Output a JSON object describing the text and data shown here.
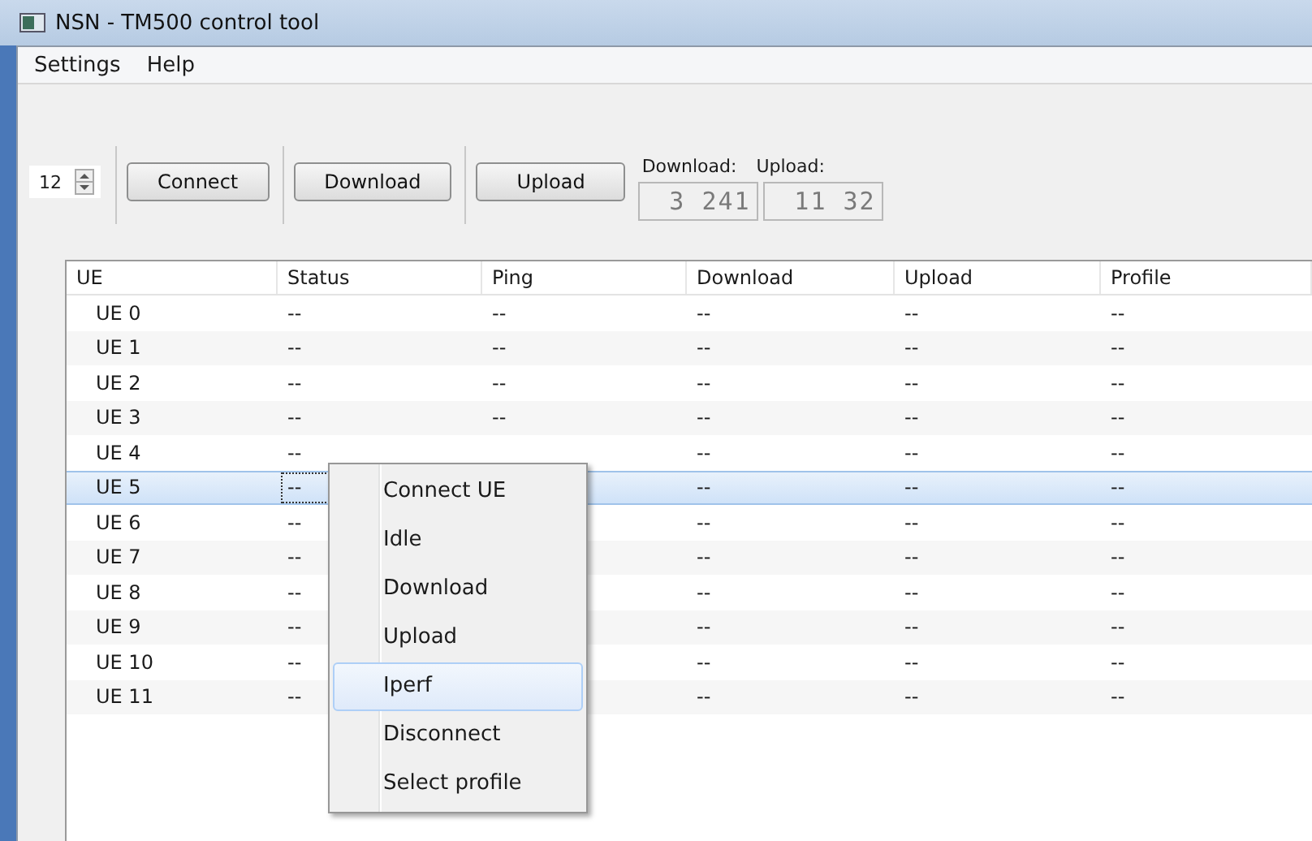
{
  "window": {
    "title": "NSN - TM500 control tool"
  },
  "menu_bar": [
    "Settings",
    "Help"
  ],
  "toolbar": {
    "ue_count": "12",
    "buttons": [
      "Connect",
      "Download",
      "Upload"
    ],
    "download_label": "Download:",
    "upload_label": "Upload:",
    "download_display": "3 241",
    "upload_display": "11 32"
  },
  "table": {
    "columns": [
      "UE",
      "Status",
      "Ping",
      "Download",
      "Upload",
      "Profile"
    ],
    "rows": [
      {
        "ue": "UE 0",
        "status": "--",
        "ping": "--",
        "download": "--",
        "upload": "--",
        "profile": "--",
        "selected": false
      },
      {
        "ue": "UE 1",
        "status": "--",
        "ping": "--",
        "download": "--",
        "upload": "--",
        "profile": "--",
        "selected": false
      },
      {
        "ue": "UE 2",
        "status": "--",
        "ping": "--",
        "download": "--",
        "upload": "--",
        "profile": "--",
        "selected": false
      },
      {
        "ue": "UE 3",
        "status": "--",
        "ping": "--",
        "download": "--",
        "upload": "--",
        "profile": "--",
        "selected": false
      },
      {
        "ue": "UE 4",
        "status": "--",
        "download": "--",
        "upload": "--",
        "profile": "--",
        "selected": false
      },
      {
        "ue": "UE 5",
        "status": "--",
        "download": "--",
        "upload": "--",
        "profile": "--",
        "selected": true
      },
      {
        "ue": "UE 6",
        "status": "--",
        "download": "--",
        "upload": "--",
        "profile": "--",
        "selected": false
      },
      {
        "ue": "UE 7",
        "status": "--",
        "download": "--",
        "upload": "--",
        "profile": "--",
        "selected": false
      },
      {
        "ue": "UE 8",
        "status": "--",
        "download": "--",
        "upload": "--",
        "profile": "--",
        "selected": false
      },
      {
        "ue": "UE 9",
        "status": "--",
        "download": "--",
        "upload": "--",
        "profile": "--",
        "selected": false
      },
      {
        "ue": "UE 10",
        "status": "--",
        "download": "--",
        "upload": "--",
        "profile": "--",
        "selected": false
      },
      {
        "ue": "UE 11",
        "status": "--",
        "download": "--",
        "upload": "--",
        "profile": "--",
        "selected": false
      }
    ]
  },
  "context_menu": {
    "items": [
      {
        "label": "Connect UE",
        "selected": false
      },
      {
        "label": "Idle",
        "selected": false
      },
      {
        "label": "Download",
        "selected": false
      },
      {
        "label": "Upload",
        "selected": false
      },
      {
        "label": "Iperf",
        "selected": true
      },
      {
        "label": "Disconnect",
        "selected": false
      },
      {
        "label": "Select profile",
        "selected": false
      }
    ]
  }
}
